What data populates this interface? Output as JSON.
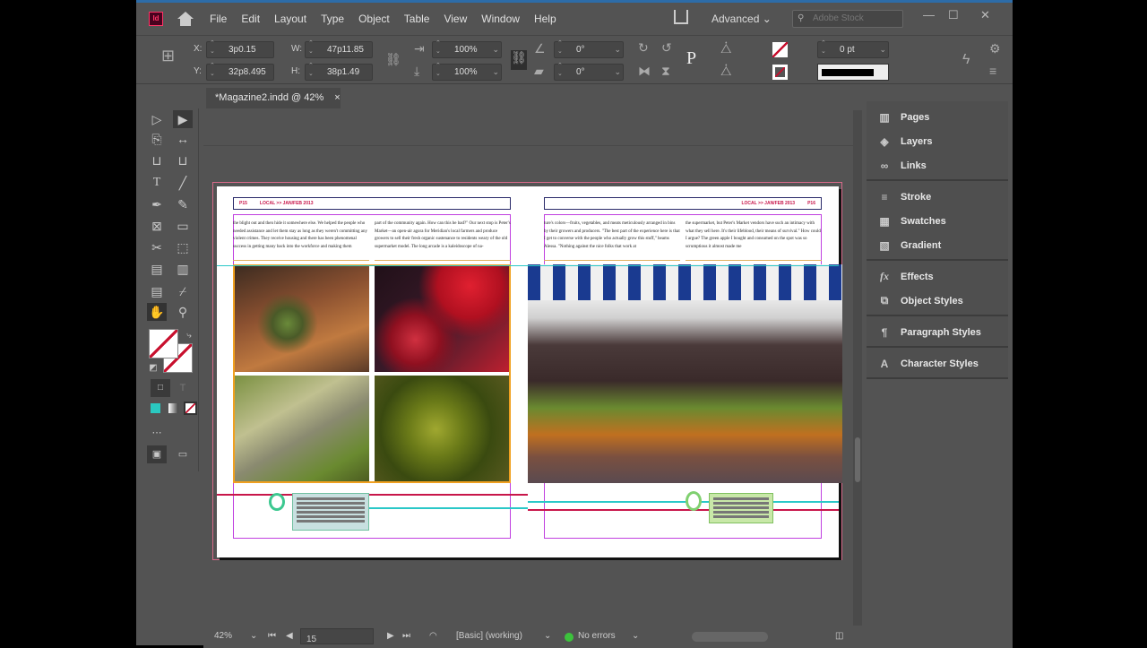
{
  "menubar": {
    "app_icon": "Id",
    "items": [
      "File",
      "Edit",
      "Layout",
      "Type",
      "Object",
      "Table",
      "View",
      "Window",
      "Help"
    ],
    "workspace": "Advanced",
    "search_placeholder": "Adobe Stock"
  },
  "control": {
    "x_label": "X:",
    "x": "3p0.15",
    "y_label": "Y:",
    "y": "32p8.495",
    "w_label": "W:",
    "w": "47p11.85",
    "h_label": "H:",
    "h": "38p1.49",
    "scale_x": "100%",
    "scale_y": "100%",
    "rotate": "0°",
    "shear": "0°",
    "stroke_weight": "0 pt"
  },
  "document_tab": {
    "title": "*Magazine2.indd @ 42%",
    "close": "×"
  },
  "spread": {
    "left_header": {
      "folio": "P15",
      "section": "LOCAL >> JAN/FEB 2013"
    },
    "right_header": {
      "section": "LOCAL >> JAN/FEB 2013",
      "folio": "P16"
    },
    "left_col1": "the blight out and then hide it somewhere else. We helped the people who needed assistance and let them stay as long as they weren't committing any violent crimes. They receive housing and there has been phenomenal success in getting many back into the workforce and making them",
    "left_col2": "part of the community again. How can this be bad?\" Our next stop is Peter's Market—an open-air agora for Meridian's local farmers and produce growers to sell their fresh organic sustenance to residents weary of the old supermarket model. The long arcade is a kaleidoscope of na-",
    "right_col1": "ture's colors—fruits, vegetables, and meats meticulously arranged in bins by their growers and producers. \"The best part of the experience here is that I get to converse with the people who actually grow this stuff,\" beams Alessa. \"Nothing against the nice folks that work at",
    "right_col2": "the supermarket, but Peter's Market vendors have such an intimacy with what they sell here. It's their lifeblood, their means of survival.\" How could I argue? The green apple I bought and consumed on the spot was so scrumptious it almost made me"
  },
  "panels": [
    {
      "items": [
        {
          "icon": "pages-icon",
          "label": "Pages"
        },
        {
          "icon": "layers-icon",
          "label": "Layers"
        },
        {
          "icon": "links-icon",
          "label": "Links"
        }
      ]
    },
    {
      "items": [
        {
          "icon": "stroke-icon",
          "label": "Stroke"
        },
        {
          "icon": "swatches-icon",
          "label": "Swatches"
        },
        {
          "icon": "gradient-icon",
          "label": "Gradient"
        }
      ]
    },
    {
      "items": [
        {
          "icon": "effects-icon",
          "label": "Effects"
        },
        {
          "icon": "object-styles-icon",
          "label": "Object Styles"
        }
      ]
    },
    {
      "items": [
        {
          "icon": "paragraph-styles-icon",
          "label": "Paragraph Styles"
        }
      ]
    },
    {
      "items": [
        {
          "icon": "character-styles-icon",
          "label": "Character Styles"
        }
      ]
    }
  ],
  "status": {
    "zoom": "42%",
    "page": "15",
    "profile": "[Basic] (working)",
    "preflight": "No errors"
  },
  "colors": {
    "accent": "#2d6ca8",
    "preflight_ok": "#3cc23c",
    "bleed": "#d86a8a",
    "margin": "#c040e0",
    "red_line": "#c8164a",
    "teal_line": "#2ac8c8"
  }
}
